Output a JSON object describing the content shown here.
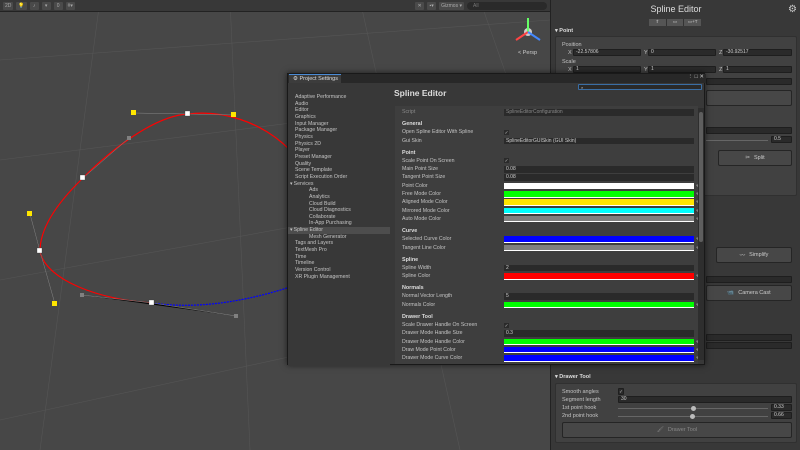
{
  "toolbar": {
    "gizmos": "Gizmos",
    "search_placeholder": "All",
    "layers_count": "0"
  },
  "scene": {
    "persp_label": "< Persp",
    "spline_color": "#ff0000",
    "selected_curve_color": "#0000ff"
  },
  "inspector": {
    "title": "Spline Editor",
    "point_section": "Point",
    "position_label": "Position",
    "position": {
      "x": "-22.57806",
      "y": "0",
      "z": "-30.92517"
    },
    "scale_label": "Scale",
    "scale": {
      "x": "1",
      "y": "1",
      "z": "1"
    },
    "axis": {
      "x": "X",
      "y": "Y",
      "z": "Z"
    },
    "slider_value": "0.5",
    "split_label": "Split",
    "simplify_label": "Simplify",
    "camera_cast_label": "Camera Cast",
    "drawer_section": "Drawer Tool",
    "smooth_angles_label": "Smooth angles",
    "smooth_angles": "✓",
    "segment_length_label": "Segment length",
    "segment_length": "30",
    "hook1_label": "1st point hook",
    "hook1": "0.33",
    "hook2_label": "2nd point hook",
    "hook2": "0.66",
    "drawer_tool_button": "Drawer Tool"
  },
  "settings": {
    "window_title": "Project Settings",
    "search_placeholder": "",
    "nav": [
      {
        "label": "Adaptive Performance",
        "indent": 0
      },
      {
        "label": "Audio",
        "indent": 0
      },
      {
        "label": "Editor",
        "indent": 0
      },
      {
        "label": "Graphics",
        "indent": 0
      },
      {
        "label": "Input Manager",
        "indent": 0
      },
      {
        "label": "Package Manager",
        "indent": 0
      },
      {
        "label": "Physics",
        "indent": 0
      },
      {
        "label": "Physics 2D",
        "indent": 0
      },
      {
        "label": "Player",
        "indent": 0
      },
      {
        "label": "Preset Manager",
        "indent": 0
      },
      {
        "label": "Quality",
        "indent": 0
      },
      {
        "label": "Scene Template",
        "indent": 0
      },
      {
        "label": "Script Execution Order",
        "indent": 0
      },
      {
        "label": "Services",
        "indent": 0,
        "expanded": true
      },
      {
        "label": "Ads",
        "indent": 1
      },
      {
        "label": "Analytics",
        "indent": 1
      },
      {
        "label": "Cloud Build",
        "indent": 1
      },
      {
        "label": "Cloud Diagnostics",
        "indent": 1
      },
      {
        "label": "Collaborate",
        "indent": 1
      },
      {
        "label": "In-App Purchasing",
        "indent": 1
      },
      {
        "label": "Spline Editor",
        "indent": 0,
        "expanded": true,
        "selected": true
      },
      {
        "label": "Mesh Generator",
        "indent": 1
      },
      {
        "label": "Tags and Layers",
        "indent": 0
      },
      {
        "label": "TextMesh Pro",
        "indent": 0
      },
      {
        "label": "Time",
        "indent": 0
      },
      {
        "label": "Timeline",
        "indent": 0
      },
      {
        "label": "Version Control",
        "indent": 0
      },
      {
        "label": "XR Plugin Management",
        "indent": 0
      }
    ],
    "content_title": "Spline Editor",
    "sections": [
      {
        "title": "",
        "rows": [
          {
            "label": "Script",
            "type": "script",
            "value": "SplineEditorConfiguration"
          }
        ]
      },
      {
        "title": "General",
        "rows": [
          {
            "label": "Open Spline Editor With Spline",
            "type": "check",
            "value": "✓"
          },
          {
            "label": "Gui Skin",
            "type": "object",
            "value": "SplineEditorGUISkin (GUI Skin)"
          }
        ]
      },
      {
        "title": "Point",
        "rows": [
          {
            "label": "Scale Point On Screen",
            "type": "check",
            "value": "✓"
          },
          {
            "label": "Main Point Size",
            "type": "text",
            "value": "0.08"
          },
          {
            "label": "Tangent Point Size",
            "type": "text",
            "value": "0.08"
          },
          {
            "label": "Point Color",
            "type": "color",
            "color": "#ffffff"
          },
          {
            "label": "Free Mode Color",
            "type": "color",
            "color": "#00ff00"
          },
          {
            "label": "Aligned Mode Color",
            "type": "color",
            "color": "#ffe600"
          },
          {
            "label": "Mirrored Mode Color",
            "type": "color",
            "color": "#00ffff"
          },
          {
            "label": "Auto Mode Color",
            "type": "color",
            "color": "#808080"
          }
        ]
      },
      {
        "title": "Curve",
        "rows": [
          {
            "label": "Selected Curve Color",
            "type": "color",
            "color": "#0000ff"
          },
          {
            "label": "Tangent Line Color",
            "type": "color",
            "color": "#808080"
          }
        ]
      },
      {
        "title": "Spline",
        "rows": [
          {
            "label": "Spline Width",
            "type": "text",
            "value": "2"
          },
          {
            "label": "Spline Color",
            "type": "color",
            "color": "#ff0000"
          }
        ]
      },
      {
        "title": "Normals",
        "rows": [
          {
            "label": "Normal Vector Length",
            "type": "text",
            "value": "5"
          },
          {
            "label": "Normals Color",
            "type": "color",
            "color": "#00ff00"
          }
        ]
      },
      {
        "title": "Drawer Tool",
        "rows": [
          {
            "label": "Scale Drawer Handle On Screen",
            "type": "check",
            "value": "✓"
          },
          {
            "label": "Drawer Mode Handle Size",
            "type": "text",
            "value": "0.3"
          },
          {
            "label": "Drawer Mode Handle Color",
            "type": "color",
            "color": "#00ff00"
          },
          {
            "label": "Draw Mode Point Color",
            "type": "color",
            "color": "#0000ff"
          },
          {
            "label": "Drawer Mode Curve Color",
            "type": "color",
            "color": "#0000ff"
          }
        ]
      }
    ]
  }
}
